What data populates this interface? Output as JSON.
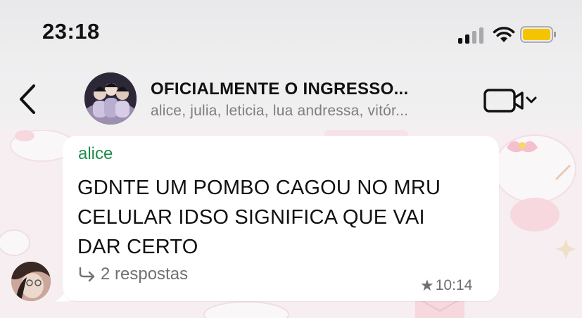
{
  "status_bar": {
    "time": "23:18"
  },
  "header": {
    "title": "OFICIALMENTE O INGRESSO...",
    "members": "alice, julia, leticia, lua andressa, vitór..."
  },
  "message": {
    "sender": "alice",
    "text": "GDNTE UM POMBO CAGOU NO MRU\nCELULAR IDSO SIGNIFICA QUE VAI\nDAR CERTO",
    "replies": "2 respostas",
    "time": "10:14"
  },
  "colors": {
    "sender_name": "#1f8b4d",
    "battery": "#f4c400"
  },
  "icons": {
    "back": "chevron-left-icon",
    "video": "video-camera-icon",
    "reply": "reply-arrow-icon",
    "starred": "star-icon"
  }
}
